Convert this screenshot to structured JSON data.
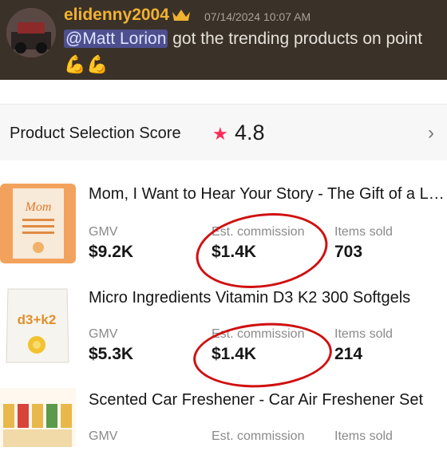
{
  "discord": {
    "username": "elidenny2004",
    "timestamp": "07/14/2024 10:07 AM",
    "mention": "@Matt Lorion",
    "message": " got the trending products on point",
    "emojis": "💪💪"
  },
  "score": {
    "label": "Product Selection Score",
    "value": "4.8"
  },
  "metric_labels": {
    "gmv": "GMV",
    "commission": "Est. commission",
    "sold": "Items sold"
  },
  "products": [
    {
      "title": "Mom, I Want to Hear Your Story - The Gift of a Lifetime",
      "gmv": "$9.2K",
      "commission": "$1.4K",
      "sold": "703",
      "thumb_text": "Mom"
    },
    {
      "title": "Micro Ingredients Vitamin D3 K2 300 Softgels",
      "gmv": "$5.3K",
      "commission": "$1.4K",
      "sold": "214",
      "thumb_text": "d3+k2"
    },
    {
      "title": "Scented Car Freshener - Car Air Freshener Set",
      "gmv": "",
      "commission": "",
      "sold": ""
    }
  ],
  "colors": {
    "discord_bg": "#3a3128",
    "username": "#f0b232",
    "mention_bg": "#4d4f8f",
    "star": "#fe2c55",
    "annotation": "#d01010"
  }
}
